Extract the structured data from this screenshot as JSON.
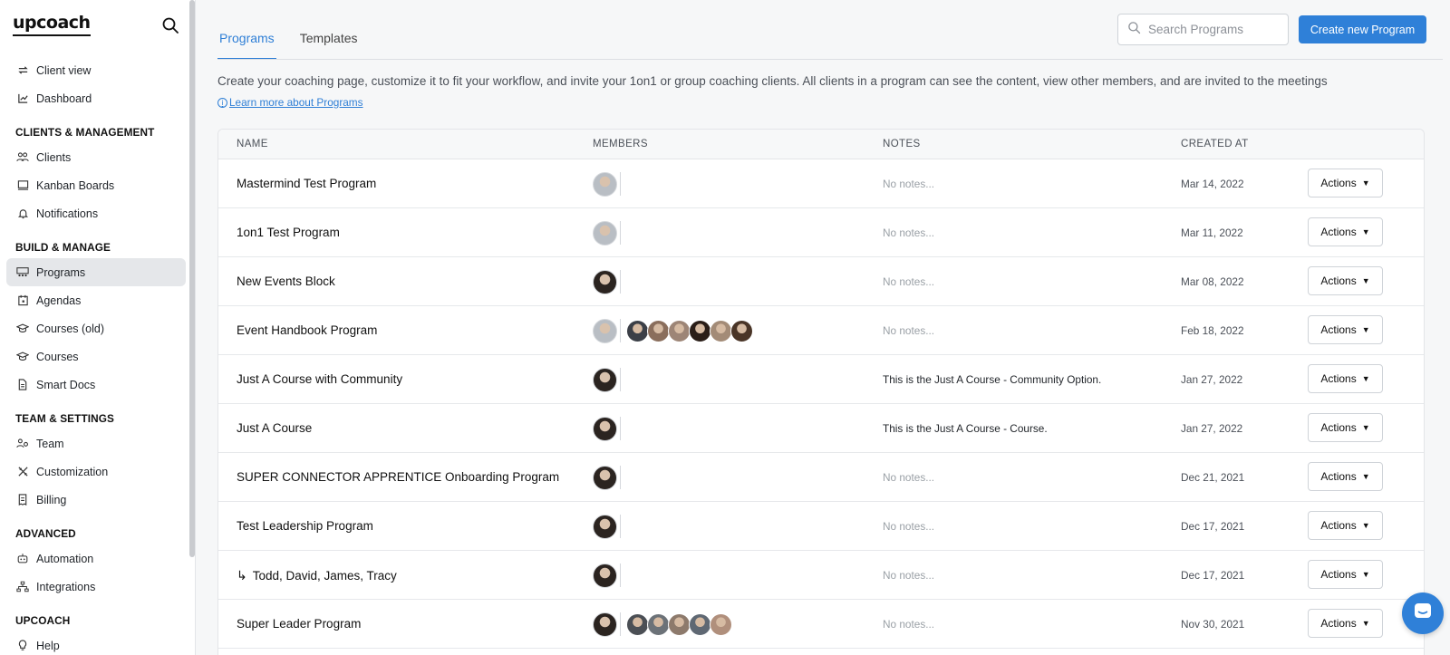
{
  "app": {
    "logo": "upcoach"
  },
  "sidebar": {
    "top_items": [
      {
        "label": "Client view",
        "icon": "switch-icon"
      },
      {
        "label": "Dashboard",
        "icon": "chart-icon"
      }
    ],
    "sections": [
      {
        "title": "CLIENTS & MANAGEMENT",
        "items": [
          {
            "label": "Clients",
            "icon": "users-icon"
          },
          {
            "label": "Kanban Boards",
            "icon": "board-icon"
          },
          {
            "label": "Notifications",
            "icon": "bell-icon"
          }
        ]
      },
      {
        "title": "BUILD & MANAGE",
        "items": [
          {
            "label": "Programs",
            "icon": "programs-icon",
            "active": true
          },
          {
            "label": "Agendas",
            "icon": "calendar-icon"
          },
          {
            "label": "Courses (old)",
            "icon": "graduation-cap-icon"
          },
          {
            "label": "Courses",
            "icon": "graduation-cap-icon"
          },
          {
            "label": "Smart Docs",
            "icon": "document-icon"
          }
        ]
      },
      {
        "title": "TEAM & SETTINGS",
        "items": [
          {
            "label": "Team",
            "icon": "team-icon"
          },
          {
            "label": "Customization",
            "icon": "tools-icon"
          },
          {
            "label": "Billing",
            "icon": "receipt-icon"
          }
        ]
      },
      {
        "title": "ADVANCED",
        "items": [
          {
            "label": "Automation",
            "icon": "robot-icon"
          },
          {
            "label": "Integrations",
            "icon": "network-icon"
          }
        ]
      },
      {
        "title": "UPCOACH",
        "items": [
          {
            "label": "Help",
            "icon": "lightbulb-icon"
          }
        ]
      }
    ]
  },
  "tabs": [
    {
      "label": "Programs",
      "active": true
    },
    {
      "label": "Templates",
      "active": false
    }
  ],
  "search": {
    "placeholder": "Search Programs",
    "value": ""
  },
  "create_button": "Create new Program",
  "description": "Create your coaching page, customize it to fit your workflow, and invite your 1on1 or group coaching clients. All clients in a program can see the content, view other members, and are invited to the meetings",
  "learn_more": "Learn more about Programs",
  "table": {
    "headers": {
      "name": "NAME",
      "members": "MEMBERS",
      "notes": "NOTES",
      "created": "CREATED AT"
    },
    "action_label": "Actions",
    "rows": [
      {
        "name": "Mastermind Test Program",
        "owner": "#b9bec4",
        "members": [],
        "notes": "No notes...",
        "notes_empty": true,
        "date": "Mar 14, 2022"
      },
      {
        "name": "1on1 Test Program",
        "owner": "#b9bec4",
        "members": [],
        "notes": "No notes...",
        "notes_empty": true,
        "date": "Mar 11, 2022"
      },
      {
        "name": "New Events Block",
        "owner": "#2b2420",
        "members": [],
        "notes": "No notes...",
        "notes_empty": true,
        "date": "Mar 08, 2022"
      },
      {
        "name": "Event Handbook Program",
        "owner": "#b9bec4",
        "members": [
          "#3b3f47",
          "#8a6e5c",
          "#9d8576",
          "#2a1e18",
          "#a38b77",
          "#4a3527"
        ],
        "notes": "No notes...",
        "notes_empty": true,
        "date": "Feb 18, 2022"
      },
      {
        "name": "Just A Course with Community",
        "owner": "#2b2420",
        "members": [],
        "notes": "This is the Just A Course - Community Option.",
        "notes_empty": false,
        "date": "Jan 27, 2022"
      },
      {
        "name": "Just A Course",
        "owner": "#2b2420",
        "members": [],
        "notes": "This is the Just A Course - Course.",
        "notes_empty": false,
        "date": "Jan 27, 2022"
      },
      {
        "name": "SUPER CONNECTOR APPRENTICE Onboarding Program",
        "owner": "#2b2420",
        "members": [],
        "notes": "No notes...",
        "notes_empty": true,
        "date": "Dec 21, 2021"
      },
      {
        "name": "Test Leadership Program",
        "owner": "#2b2420",
        "members": [],
        "notes": "No notes...",
        "notes_empty": true,
        "date": "Dec 17, 2021"
      },
      {
        "name": "Todd, David, James, Tracy",
        "sub": true,
        "owner": "#2b2420",
        "members": [],
        "notes": "No notes...",
        "notes_empty": true,
        "date": "Dec 17, 2021"
      },
      {
        "name": "Super Leader Program",
        "owner": "#2b2420",
        "members": [
          "#4b4f55",
          "#6c7278",
          "#8d7a6c",
          "#5f6873",
          "#b08f7c"
        ],
        "notes": "No notes...",
        "notes_empty": true,
        "date": "Nov 30, 2021"
      }
    ]
  },
  "colors": {
    "accent": "#2f80d8",
    "active_nav": "#e5e7ea"
  }
}
